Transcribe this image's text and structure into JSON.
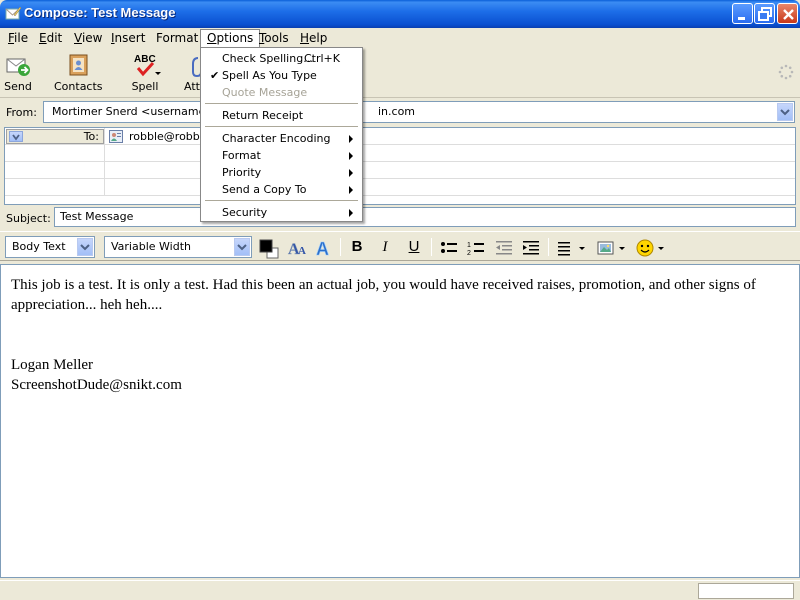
{
  "window": {
    "title": "Compose: Test Message",
    "controls": [
      "minimize",
      "maximize",
      "close"
    ]
  },
  "menubar": [
    {
      "label": "File",
      "ul": "F",
      "rest": "ile"
    },
    {
      "label": "Edit",
      "ul": "E",
      "rest": "dit"
    },
    {
      "label": "View",
      "ul": "V",
      "rest": "iew"
    },
    {
      "label": "Insert",
      "ul": "I",
      "rest": "nsert"
    },
    {
      "label": "Format",
      "ul": "",
      "rest": "Format"
    },
    {
      "label": "Options",
      "ul": "O",
      "rest": "ptions"
    },
    {
      "label": "Tools",
      "ul": "T",
      "rest": "ools"
    },
    {
      "label": "Help",
      "ul": "H",
      "rest": "elp"
    }
  ],
  "toolbar": {
    "send": "Send",
    "contacts": "Contacts",
    "spell": "Spell",
    "attach": "Att"
  },
  "header": {
    "from_label": "From:",
    "from_value_left": "Mortimer Snerd <username@d",
    "from_value_right": "in.com",
    "to_label": "To:",
    "to_value": "robble@robble",
    "subject_label": "Subject:",
    "subject_value": "Test Message"
  },
  "format_toolbar": {
    "paragraph_style": "Body Text",
    "font": "Variable Width",
    "text_color": "#000000",
    "bold": "B",
    "italic": "I",
    "underline": "U"
  },
  "body": {
    "line1": "This job is a test.  It is only a test.  Had this been an actual job, you would have received raises, promotion, and other signs of",
    "line2": "appreciation... heh heh....",
    "sig_name": "Logan Meller",
    "sig_email": "ScreenshotDude@snikt.com"
  },
  "options_menu": {
    "check_spelling": "Check Spelling...",
    "check_spelling_shortcut": "Ctrl+K",
    "spell_as_you_type": "Spell As You Type",
    "spell_as_you_type_checked": true,
    "quote_message": "Quote Message",
    "return_receipt": "Return Receipt",
    "character_encoding": "Character Encoding",
    "format": "Format",
    "priority": "Priority",
    "send_copy_to": "Send a Copy To",
    "security": "Security"
  },
  "colors": {
    "titlebar": "#0a5fd8",
    "chrome": "#ece9d8",
    "field_border": "#7f9db9",
    "disabled_text": "#a6a397"
  }
}
